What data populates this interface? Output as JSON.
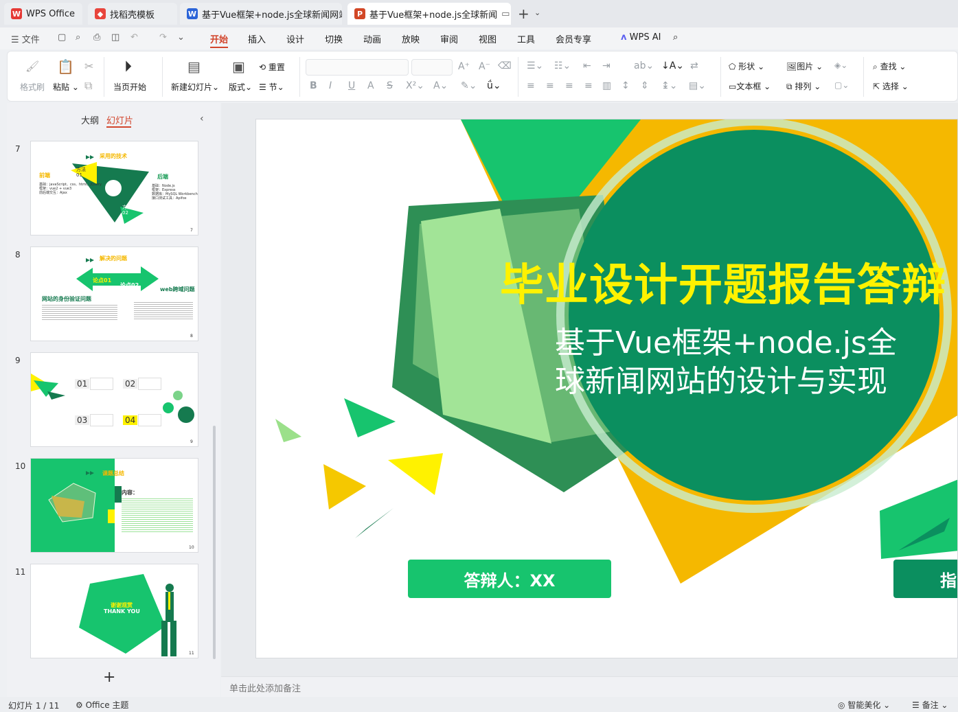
{
  "tabs": [
    {
      "label": "WPS Office",
      "icon": "wps-logo-icon"
    },
    {
      "label": "找稻壳模板",
      "icon": "docer-icon"
    },
    {
      "label": "基于Vue框架+node.js全球新闻网站",
      "icon": "word-icon"
    },
    {
      "label": "基于Vue框架+node.js全球新闻",
      "icon": "ppt-icon"
    }
  ],
  "menu": {
    "file": "文件",
    "items": [
      "开始",
      "插入",
      "设计",
      "切换",
      "动画",
      "放映",
      "审阅",
      "视图",
      "工具",
      "会员专享"
    ],
    "active": "开始",
    "ai": "WPS AI"
  },
  "ribbon": {
    "format_painter": "格式刷",
    "paste": "粘贴",
    "from_current": "当页开始",
    "new_slide": "新建幻灯片",
    "layout": "版式",
    "reset": "重置",
    "section": "节",
    "shape": "形状",
    "picture": "图片",
    "textbox": "文本框",
    "arrange": "排列",
    "find": "查找",
    "select": "选择"
  },
  "left_panel": {
    "outline_tab": "大纲",
    "slides_tab": "幻灯片",
    "slides": [
      {
        "num": "7",
        "title": "采用的技术",
        "front": "前端",
        "back": "后端",
        "m1": "方法\n01",
        "m2": "方法\n02",
        "front_text": "基础：javaScript、css、html、JQuery\n框架：vue2 + vue3\n前后端交互：Ajax",
        "back_text": "基础：Node.js\n框架：Express\n数据库：MySQL Workbench\n接口测试工具：Apifox"
      },
      {
        "num": "8",
        "title": "解决的问题",
        "arg1": "论点01",
        "arg2": "论点02",
        "web": "web跨域问题",
        "identity": "网站的身份验证问题"
      },
      {
        "num": "9",
        "items": [
          "01",
          "02",
          "03",
          "04"
        ]
      },
      {
        "num": "10",
        "title": "课题总结",
        "content": "内容："
      },
      {
        "num": "11",
        "thanks": "谢谢观赏",
        "thank_you": "THANK YOU"
      }
    ],
    "add": "+"
  },
  "slide": {
    "title": "毕业设计开题报告答辩",
    "subtitle": "基于Vue框架+node.js全球新闻网站的设计与实现",
    "defender": "答辩人：XX",
    "advisor": "指"
  },
  "notes_placeholder": "单击此处添加备注",
  "status": {
    "slide_count": "幻灯片 1 / 11",
    "theme": "Office 主题",
    "beautify": "智能美化",
    "notes": "备注"
  },
  "colors": {
    "accent": "#d2452c",
    "dark_green": "#0b8f5f",
    "green": "#17c46e",
    "yellow": "#f5b800",
    "title_yellow": "#fff200"
  }
}
